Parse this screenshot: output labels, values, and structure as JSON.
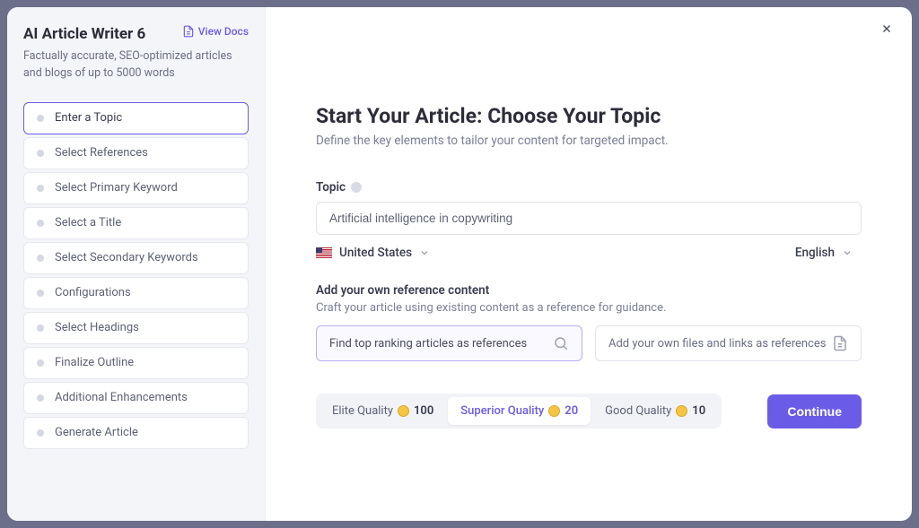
{
  "sidebar": {
    "title": "AI Article Writer 6",
    "view_docs_label": "View Docs",
    "subtitle": "Factually accurate, SEO-optimized articles and blogs of up to 5000 words",
    "steps": [
      {
        "label": "Enter a Topic",
        "active": true
      },
      {
        "label": "Select References",
        "active": false
      },
      {
        "label": "Select Primary Keyword",
        "active": false
      },
      {
        "label": "Select a Title",
        "active": false
      },
      {
        "label": "Select Secondary Keywords",
        "active": false
      },
      {
        "label": "Configurations",
        "active": false
      },
      {
        "label": "Select Headings",
        "active": false
      },
      {
        "label": "Finalize Outline",
        "active": false
      },
      {
        "label": "Additional Enhancements",
        "active": false
      },
      {
        "label": "Generate Article",
        "active": false
      }
    ]
  },
  "main": {
    "title": "Start Your Article: Choose Your Topic",
    "subtitle": "Define the key elements to tailor your content for targeted impact.",
    "topic_label": "Topic",
    "topic_value": "Artificial intelligence in copywriting",
    "country_label": "United States",
    "language_label": "English",
    "reference_title": "Add your own reference content",
    "reference_subtitle": "Craft your article using existing content as a reference for guidance.",
    "reference_options": [
      {
        "label": "Find top ranking articles as references",
        "selected": true
      },
      {
        "label": "Add your own files and links as references",
        "selected": false
      }
    ],
    "quality_options": [
      {
        "label": "Elite Quality",
        "count": "100",
        "selected": false
      },
      {
        "label": "Superior Quality",
        "count": "20",
        "selected": true
      },
      {
        "label": "Good Quality",
        "count": "10",
        "selected": false
      }
    ],
    "continue_label": "Continue"
  }
}
